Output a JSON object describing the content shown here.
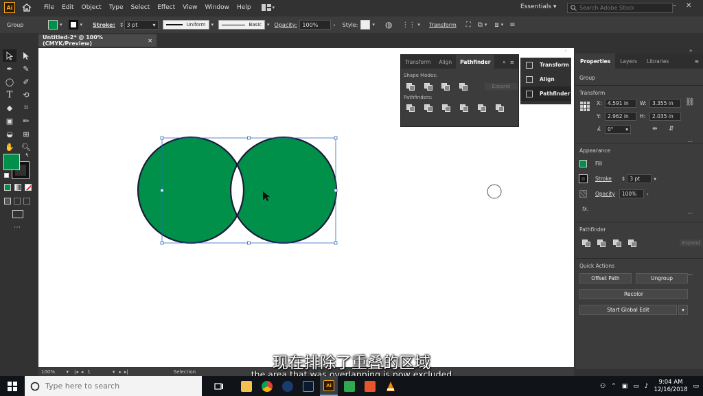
{
  "menubar": {
    "logo": "Ai",
    "items": [
      "File",
      "Edit",
      "Object",
      "Type",
      "Select",
      "Effect",
      "View",
      "Window",
      "Help"
    ],
    "workspace": "Essentials",
    "stock_placeholder": "Search Adobe Stock"
  },
  "control": {
    "selection": "Group",
    "stroke_label": "Stroke:",
    "stroke_value": "3 pt",
    "profile": "Uniform",
    "brush": "Basic",
    "opacity_label": "Opacity:",
    "opacity_value": "100%",
    "style_label": "Style:",
    "transform": "Transform"
  },
  "document": {
    "tab": "Untitled-2* @ 100% (CMYK/Preview)"
  },
  "colors": {
    "fill": "#00904a",
    "stroke": "#1b1a3a",
    "accent": "#2d6cc0"
  },
  "pathfinder_panel": {
    "tabs": [
      "Transform",
      "Align",
      "Pathfinder"
    ],
    "active": "Pathfinder",
    "shape_modes": "Shape Modes:",
    "pathfinders": "Pathfinders:",
    "expand": "Expand"
  },
  "dock": {
    "items": [
      "Transform",
      "Align",
      "Pathfinder"
    ]
  },
  "properties": {
    "tabs": [
      "Properties",
      "Layers",
      "Libraries"
    ],
    "selection": "Group",
    "transform_title": "Transform",
    "x_label": "X:",
    "x": "4.591 in",
    "y_label": "Y:",
    "y": "2.962 in",
    "w_label": "W:",
    "w": "3.355 in",
    "h_label": "H:",
    "h": "2.035 in",
    "angle": "0°",
    "appearance_title": "Appearance",
    "fill_label": "Fill",
    "stroke_label": "Stroke",
    "stroke_value": "3 pt",
    "opacity_label": "Opacity",
    "opacity_value": "100%",
    "fx": "fx.",
    "pathfinder_title": "Pathfinder",
    "expand": "Expand",
    "quick_actions_title": "Quick Actions",
    "offset_path": "Offset Path",
    "ungroup": "Ungroup",
    "recolor": "Recolor",
    "global_edit": "Start Global Edit"
  },
  "status": {
    "zoom": "100%",
    "page": "1",
    "tool": "Selection"
  },
  "subtitles": {
    "zh": "现在排除了重叠的区域",
    "en": "the area that was overlapping is now excluded"
  },
  "taskbar": {
    "search_placeholder": "Type here to search",
    "time": "9:04 AM",
    "date": "12/16/2018"
  }
}
